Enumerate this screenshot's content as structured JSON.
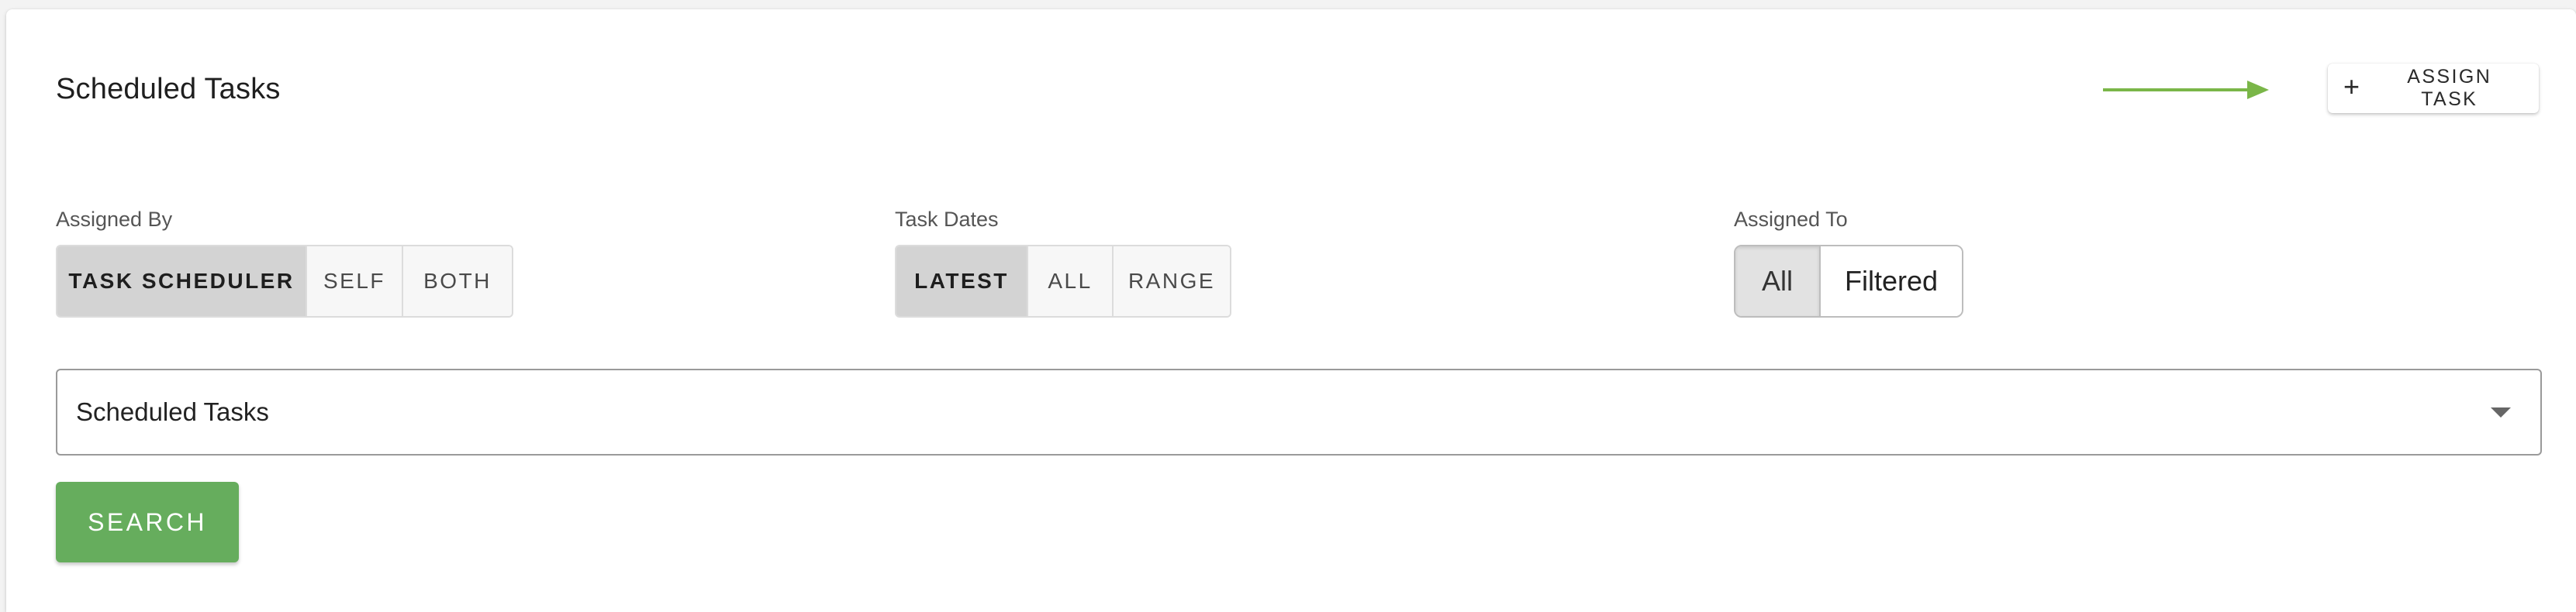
{
  "header": {
    "title": "Scheduled Tasks",
    "assign_label": "ASSIGN TASK",
    "assign_icon": "plus-icon",
    "arrow_color": "#7ab648"
  },
  "assigned_by": {
    "label": "Assigned By",
    "options": [
      "TASK SCHEDULER",
      "SELF",
      "BOTH"
    ],
    "selected": "TASK SCHEDULER"
  },
  "task_dates": {
    "label": "Task Dates",
    "options": [
      "LATEST",
      "ALL",
      "RANGE"
    ],
    "selected": "LATEST"
  },
  "assigned_to": {
    "label": "Assigned To",
    "options": [
      "All",
      "Filtered"
    ],
    "selected": "All"
  },
  "task_select": {
    "value": "Scheduled Tasks",
    "icon": "caret-down-icon"
  },
  "search": {
    "label": "SEARCH",
    "color": "#66ad5d"
  }
}
